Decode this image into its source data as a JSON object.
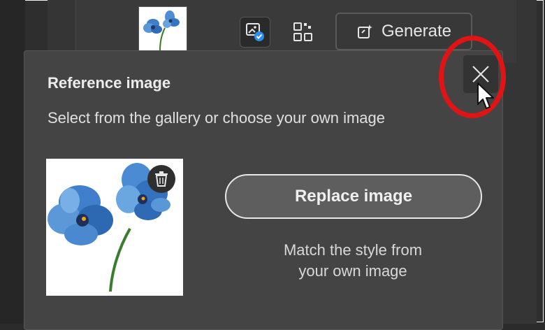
{
  "toolbar": {
    "generate_label": "Generate",
    "reference_icon": "reference-image-icon",
    "qr_icon": "effects-icon"
  },
  "popover": {
    "title": "Reference image",
    "subtitle": "Select from the gallery or choose your own image",
    "replace_label": "Replace image",
    "match_line1": "Match the style from",
    "match_line2": "your own image",
    "close_icon": "close-icon",
    "delete_icon": "trash-icon"
  },
  "colors": {
    "highlight": "#e01414",
    "popover_bg": "#444444",
    "button_bg": "#5e5e5e"
  }
}
